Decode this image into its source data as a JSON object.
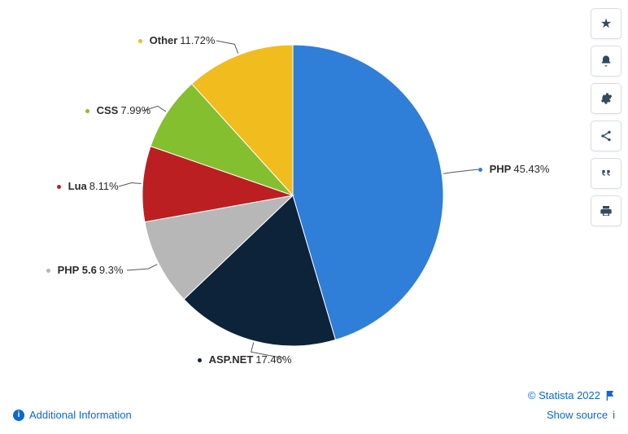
{
  "chart_data": {
    "type": "pie",
    "title": "",
    "series": [
      {
        "name": "PHP",
        "value": 45.43,
        "color": "#2f7ed8"
      },
      {
        "name": "ASP.NET",
        "value": 17.46,
        "color": "#0d233a"
      },
      {
        "name": "PHP 5.6",
        "value": 9.3,
        "color": "#b7b7b7"
      },
      {
        "name": "Lua",
        "value": 8.11,
        "color": "#bb1f21"
      },
      {
        "name": "CSS",
        "value": 7.99,
        "color": "#84bf30"
      },
      {
        "name": "Other",
        "value": 11.72,
        "color": "#f0bc1e"
      }
    ],
    "value_suffix": "%"
  },
  "labels": {
    "php": {
      "name": "PHP",
      "value": "45.43%"
    },
    "aspnet": {
      "name": "ASP.NET",
      "value": "17.46%"
    },
    "php56": {
      "name": "PHP 5.6",
      "value": "9.3%"
    },
    "lua": {
      "name": "Lua",
      "value": "8.11%"
    },
    "css": {
      "name": "CSS",
      "value": "7.99%"
    },
    "other": {
      "name": "Other",
      "value": "11.72%"
    }
  },
  "footer": {
    "additional_info": "Additional Information",
    "copyright": "© Statista 2022",
    "show_source": "Show source"
  },
  "actions": {
    "favorite": "favorite",
    "notify": "notify",
    "settings": "settings",
    "share": "share",
    "cite": "cite",
    "print": "print"
  }
}
